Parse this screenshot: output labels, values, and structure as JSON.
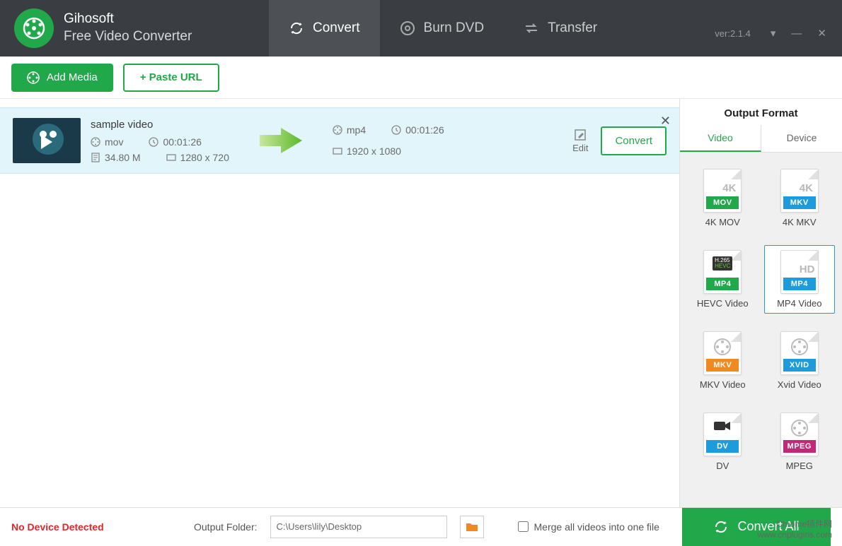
{
  "app": {
    "name": "Gihosoft",
    "subtitle": "Free Video Converter",
    "version": "ver:2.1.4"
  },
  "mainTabs": {
    "convert": "Convert",
    "burn": "Burn DVD",
    "transfer": "Transfer"
  },
  "toolbar": {
    "addMedia": "Add Media",
    "pasteUrl": "+ Paste URL"
  },
  "item": {
    "title": "sample video",
    "srcFormat": "mov",
    "srcDuration": "00:01:26",
    "srcSize": "34.80 M",
    "srcRes": "1280 x 720",
    "outFormat": "mp4",
    "outDuration": "00:01:26",
    "outRes": "1920 x 1080",
    "edit": "Edit",
    "convert": "Convert"
  },
  "outputFormat": {
    "title": "Output Format",
    "tabs": {
      "video": "Video",
      "device": "Device"
    },
    "items": [
      {
        "top": "4K",
        "badge": "MOV",
        "badgeColor": "#21a84a",
        "label": "4K MOV"
      },
      {
        "top": "4K",
        "badge": "MKV",
        "badgeColor": "#1e9bda",
        "label": "4K MKV"
      },
      {
        "top": "H.265",
        "badge": "MP4",
        "badgeColor": "#21a84a",
        "label": "HEVC Video",
        "topSmall": true
      },
      {
        "top": "HD",
        "badge": "MP4",
        "badgeColor": "#1e9bda",
        "label": "MP4 Video",
        "selected": true
      },
      {
        "top": "reel",
        "badge": "MKV",
        "badgeColor": "#f08a1f",
        "label": "MKV Video"
      },
      {
        "top": "reel",
        "badge": "XVID",
        "badgeColor": "#1e9bda",
        "label": "Xvid Video"
      },
      {
        "top": "cam",
        "badge": "DV",
        "badgeColor": "#1e9bda",
        "label": "DV"
      },
      {
        "top": "reel",
        "badge": "MPEG",
        "badgeColor": "#c02878",
        "label": "MPEG"
      }
    ]
  },
  "footer": {
    "noDevice": "No Device Detected",
    "outputFolderLabel": "Output Folder:",
    "outputFolderValue": "C:\\Users\\lily\\Desktop",
    "merge": "Merge all videos into one file",
    "convertAll": "Convert All"
  },
  "watermark": {
    "line1": "Chrome插件网",
    "line2": "www.cnplugins.com"
  }
}
